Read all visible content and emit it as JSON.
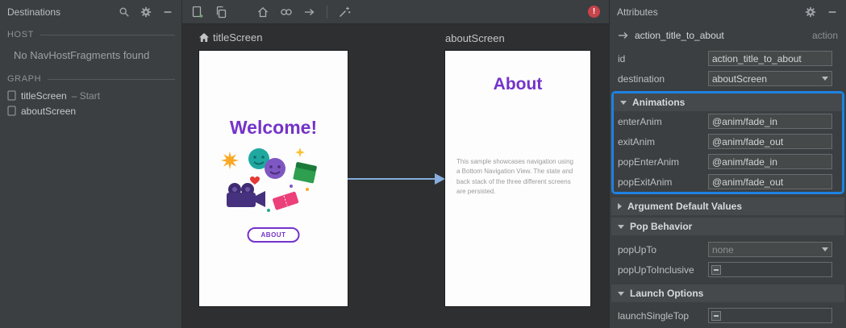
{
  "colors": {
    "selection_blue": "#1d82e2",
    "brand_purple": "#7433c9",
    "action_arrow_blue": "#87aedd",
    "error_red": "#c7444a"
  },
  "destinations_panel": {
    "title": "Destinations",
    "host_label": "HOST",
    "host_message": "No NavHostFragments found",
    "graph_label": "GRAPH",
    "items": [
      {
        "label": "titleScreen",
        "suffix": "– Start"
      },
      {
        "label": "aboutScreen",
        "suffix": ""
      }
    ]
  },
  "toolbar": {
    "error_text": "!"
  },
  "canvas": {
    "screens": [
      {
        "label": "titleScreen",
        "title": "Welcome!",
        "button_label": "ABOUT"
      },
      {
        "label": "aboutScreen",
        "title": "About",
        "body": "This sample showcases navigation using a Bottom Navigation View. The state and back stack of the three different screens are persisted."
      }
    ]
  },
  "attributes_panel": {
    "title": "Attributes",
    "action": {
      "name": "action_title_to_about",
      "type": "action"
    },
    "id_row": {
      "label": "id",
      "value": "action_title_to_about"
    },
    "destination_row": {
      "label": "destination",
      "value": "aboutScreen"
    },
    "animations": {
      "header": "Animations",
      "rows": [
        {
          "label": "enterAnim",
          "value": "@anim/fade_in"
        },
        {
          "label": "exitAnim",
          "value": "@anim/fade_out"
        },
        {
          "label": "popEnterAnim",
          "value": "@anim/fade_in"
        },
        {
          "label": "popExitAnim",
          "value": "@anim/fade_out"
        }
      ]
    },
    "argument_defaults": {
      "header": "Argument Default Values"
    },
    "pop_behavior": {
      "header": "Pop Behavior",
      "pop_up_to": {
        "label": "popUpTo",
        "value": "none"
      },
      "pop_up_to_inclusive": {
        "label": "popUpToInclusive"
      }
    },
    "launch_options": {
      "header": "Launch Options",
      "launch_single_top": {
        "label": "launchSingleTop"
      }
    }
  },
  "icons": {
    "search-icon": "magnifier",
    "gear-icon": "settings gear",
    "minimize-icon": "minus",
    "new-destination-icon": "document with green plus",
    "duplicate-icon": "two overlapping sheets",
    "home-icon": "house",
    "deeplink-icon": "chain link",
    "action-icon": "right arrow",
    "auto-arrange-icon": "magic wand with sparkles",
    "error-icon": "red circle with exclamation",
    "destination-icon": "phone screen outline",
    "start-destination-home-icon": "house",
    "dropdown-arrow-icon": "down triangle",
    "collapse-triangle-icon": "down triangle",
    "expand-triangle-icon": "right triangle",
    "indeterminate-checkbox-icon": "dash"
  }
}
